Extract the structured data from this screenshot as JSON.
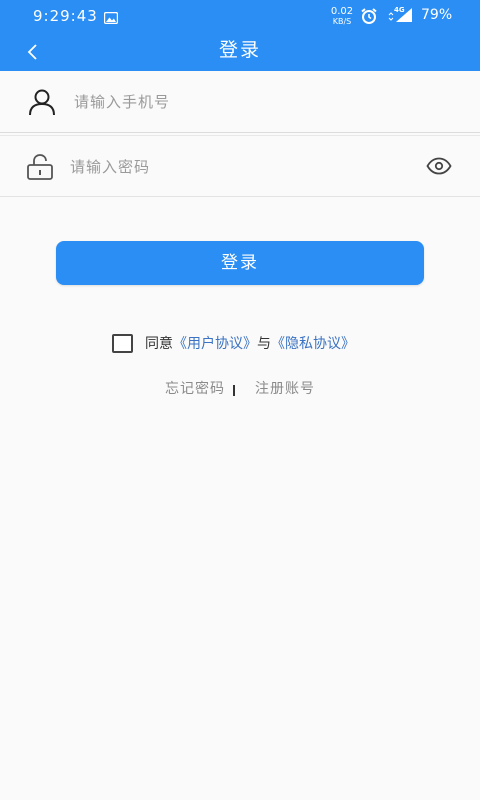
{
  "status_bar": {
    "time": "9:29:43",
    "net_speed_value": "0.02",
    "net_speed_unit": "KB/S",
    "network_type": "4G",
    "battery": "79%",
    "icons": [
      "image-icon",
      "alarm-icon",
      "signal-icon"
    ]
  },
  "nav": {
    "title": "登录",
    "back_icon": "chevron-left-icon"
  },
  "form": {
    "phone_placeholder": "请输入手机号",
    "password_placeholder": "请输入密码",
    "phone_icon": "user-icon",
    "password_icon": "lock-icon",
    "visibility_icon": "eye-icon"
  },
  "login_button": "登录",
  "agreement": {
    "prefix": "同意",
    "user_agreement": "《用户协议》",
    "conjunction": "与",
    "privacy_policy": "《隐私协议》",
    "checked": false
  },
  "links": {
    "forgot_password": "忘记密码",
    "register": "注册账号"
  },
  "colors": {
    "primary": "#2a8ef5",
    "link": "#3b73c2",
    "background": "#fafafa"
  }
}
